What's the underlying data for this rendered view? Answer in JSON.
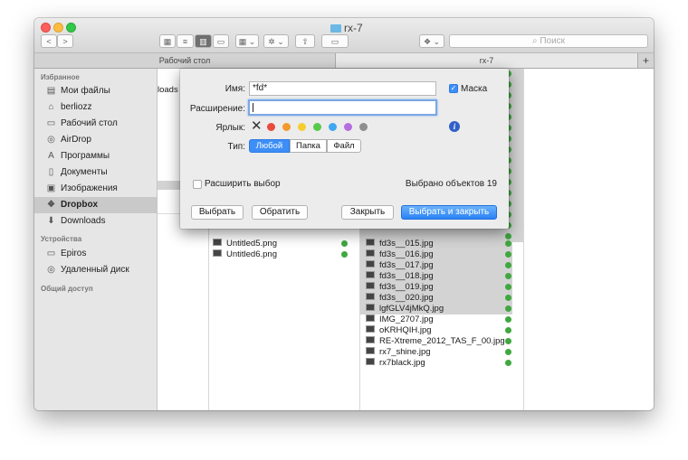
{
  "window": {
    "title": "rx-7"
  },
  "toolbar": {
    "search_placeholder": "Поиск",
    "nav_back": "<",
    "nav_forward": ">"
  },
  "tabs": [
    {
      "label": "Рабочий стол"
    },
    {
      "label": "rx-7"
    }
  ],
  "sidebar": {
    "favorites_header": "Избранное",
    "favorites": [
      {
        "label": "Мои файлы",
        "icon": "all-files-icon"
      },
      {
        "label": "berliozz",
        "icon": "home-icon"
      },
      {
        "label": "Рабочий стол",
        "icon": "desktop-icon"
      },
      {
        "label": "AirDrop",
        "icon": "airdrop-icon"
      },
      {
        "label": "Программы",
        "icon": "applications-icon"
      },
      {
        "label": "Документы",
        "icon": "documents-icon"
      },
      {
        "label": "Изображения",
        "icon": "pictures-icon"
      },
      {
        "label": "Dropbox",
        "icon": "dropbox-icon"
      },
      {
        "label": "Downloads",
        "icon": "downloads-icon"
      }
    ],
    "devices_header": "Устройства",
    "devices": [
      {
        "label": "Epiros",
        "icon": "computer-icon"
      },
      {
        "label": "Удаленный диск",
        "icon": "disc-icon"
      }
    ],
    "shared_header": "Общий доступ"
  },
  "column1": {
    "partial": [
      "loads"
    ]
  },
  "column2": {
    "files": [
      {
        "name": "Untitled5.png"
      },
      {
        "name": "Untitled6.png"
      }
    ]
  },
  "column3": {
    "selected_files": [
      "fd3s__015.jpg",
      "fd3s__016.jpg",
      "fd3s__017.jpg",
      "fd3s__018.jpg",
      "fd3s__019.jpg",
      "fd3s__020.jpg"
    ],
    "files": [
      "lgfGLV4jMkQ.jpg",
      "IMG_2707.jpg",
      "oKRHQIH.jpg",
      "RE-Xtreme_2012_TAS_F_00.jpg",
      "rx7_shine.jpg",
      "rx7black.jpg"
    ]
  },
  "dialog": {
    "name_label": "Имя:",
    "name_value": "*fd*",
    "case_label": "Маска",
    "case_checked": true,
    "ext_label": "Расширение:",
    "ext_value": "",
    "tag_label": "Ярлык:",
    "tag_colors": [
      "#e84a3e",
      "#f29a2e",
      "#f5cd2e",
      "#59c94b",
      "#3fa8f0",
      "#b56ee0",
      "#8e8e8e"
    ],
    "type_label": "Тип:",
    "types": [
      "Любой",
      "Папка",
      "Файл"
    ],
    "active_type": "Любой",
    "expand_label": "Расширить выбор",
    "selected_count": "Выбрано объектов 19",
    "btn_select": "Выбрать",
    "btn_invert": "Обратить",
    "btn_close": "Закрыть",
    "btn_select_close": "Выбрать и закрыть"
  }
}
